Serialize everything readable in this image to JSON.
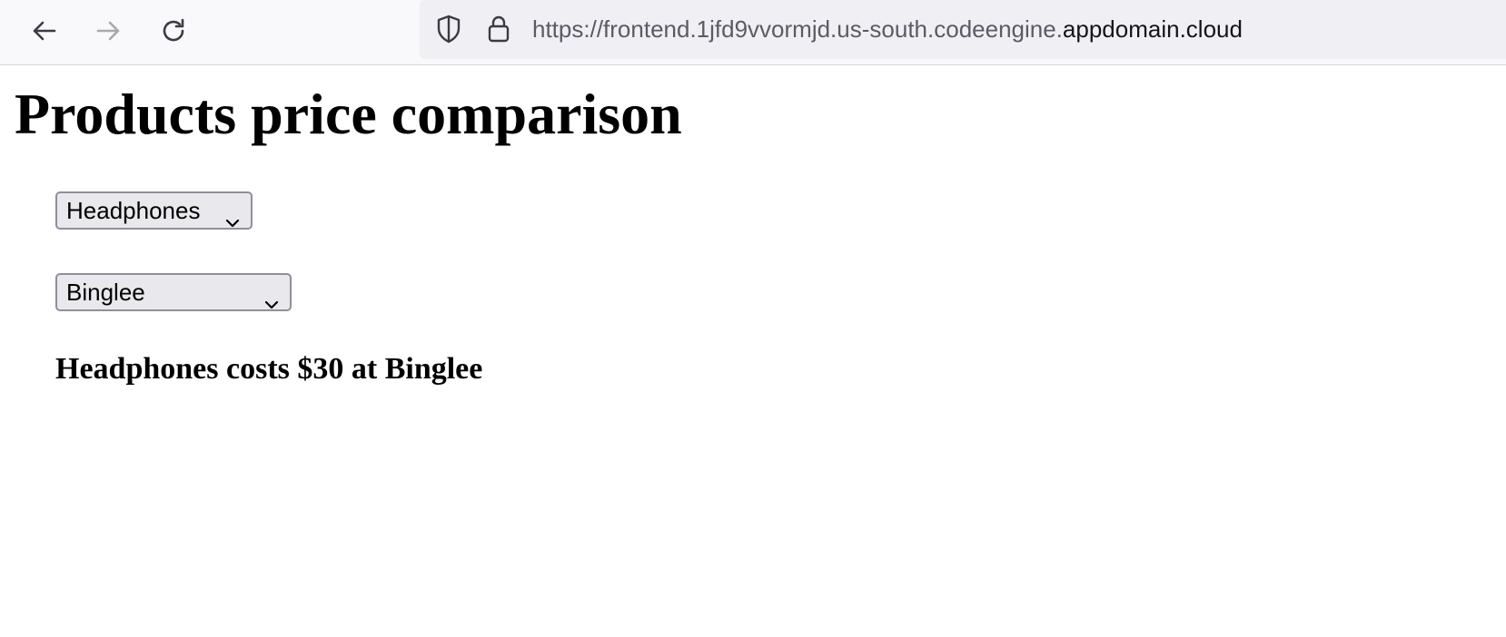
{
  "browser": {
    "url_prefix": "https://frontend.1jfd9vvormjd.us-south.codeengine.",
    "url_domain": "appdomain.cloud",
    "icons": {
      "back": "arrow-left-icon",
      "forward": "arrow-right-icon",
      "reload": "reload-icon",
      "tracking": "shield-icon",
      "security": "lock-icon"
    }
  },
  "page": {
    "title": "Products price comparison",
    "product_select": {
      "selected": "Headphones"
    },
    "store_select": {
      "selected": "Binglee"
    },
    "result_text": "Headphones costs $30 at Binglee"
  }
}
